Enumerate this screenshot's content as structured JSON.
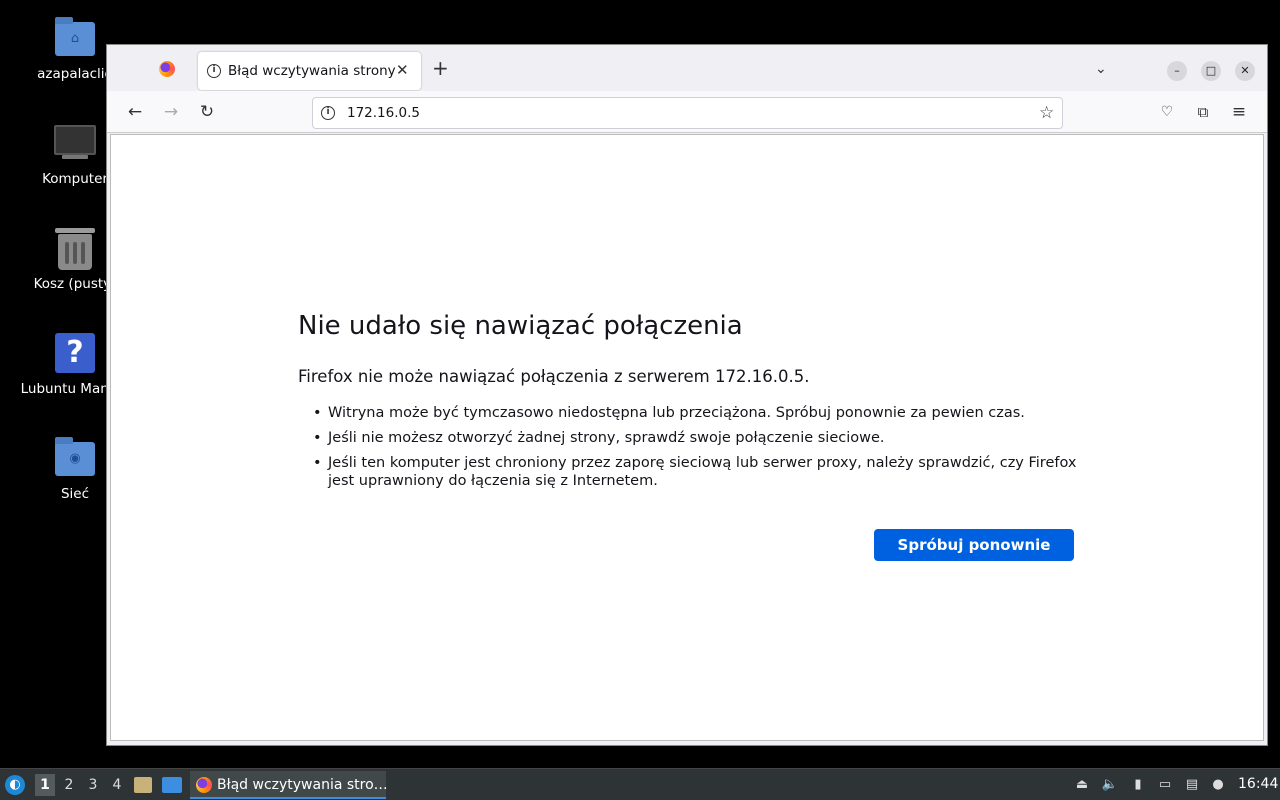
{
  "desktop": {
    "icons": [
      {
        "label": "azapalaclie",
        "icon": "home-folder-icon"
      },
      {
        "label": "Komputer",
        "icon": "computer-icon"
      },
      {
        "label": "Kosz (pusty)",
        "icon": "trash-icon"
      },
      {
        "label": "Lubuntu Manual",
        "icon": "help-icon"
      },
      {
        "label": "Sieć",
        "icon": "network-folder-icon"
      }
    ]
  },
  "browser": {
    "tab_title": "Błąd wczytywania strony",
    "url": "172.16.0.5",
    "pinned_tab_icon": "firefox-icon",
    "nav_icons": [
      "back-icon",
      "forward-icon",
      "reload-icon"
    ],
    "toolbar_icons": [
      "pocket-icon",
      "extensions-icon",
      "menu-icon"
    ]
  },
  "error_page": {
    "title": "Nie udało się nawiązać połączenia",
    "description": "Firefox nie może nawiązać połączenia z serwerem 172.16.0.5.",
    "bullets": [
      "Witryna może być tymczasowo niedostępna lub przeciążona. Spróbuj ponownie za pewien czas.",
      "Jeśli nie możesz otworzyć żadnej strony, sprawdź swoje połączenie sieciowe.",
      "Jeśli ten komputer jest chroniony przez zaporę sieciową lub serwer proxy, należy sprawdzić, czy Firefox jest uprawniony do łączenia się z Internetem."
    ],
    "retry_label": "Spróbuj ponownie",
    "button_color": "#0061e0"
  },
  "taskbar": {
    "workspaces": [
      "1",
      "2",
      "3",
      "4"
    ],
    "active_workspace": "1",
    "task_label": "Błąd wczytywania stro…",
    "clock": "16:44"
  }
}
